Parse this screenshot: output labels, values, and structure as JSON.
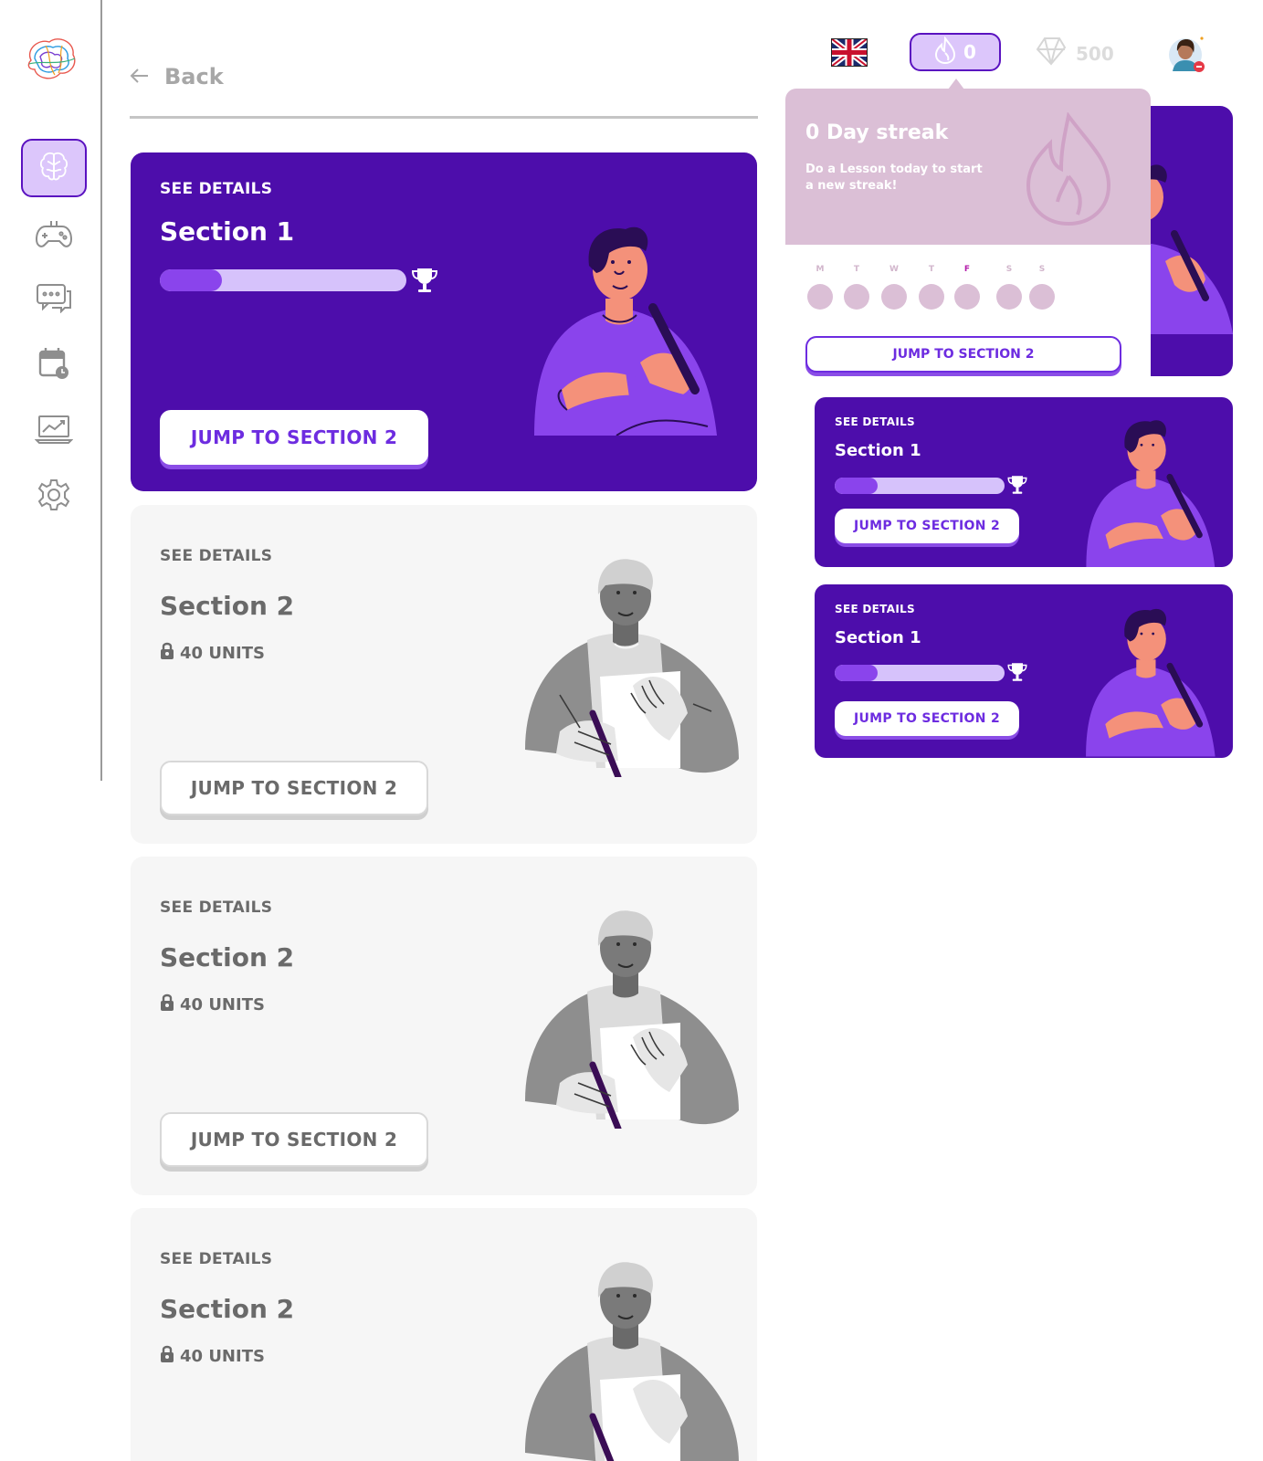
{
  "nav": {
    "back_label": "Back",
    "items": [
      {
        "name": "brain-icon",
        "active": true
      },
      {
        "name": "gamepad-icon",
        "active": false
      },
      {
        "name": "chat-icon",
        "active": false
      },
      {
        "name": "calendar-icon",
        "active": false
      },
      {
        "name": "chart-icon",
        "active": false
      },
      {
        "name": "gear-icon",
        "active": false
      }
    ]
  },
  "topbar": {
    "streak_count": "0",
    "gems": "500"
  },
  "streak_popup": {
    "title": "0 Day streak",
    "text": "Do a Lesson today to start a new streak!",
    "days": [
      "M",
      "T",
      "W",
      "T",
      "F",
      "S",
      "S"
    ],
    "today_index": 4,
    "button_label": "JUMP TO SECTION 2"
  },
  "sections": [
    {
      "see_details": "SEE DETAILS",
      "title": "Section 1",
      "button": "JUMP TO SECTION 2",
      "progress": 0.25,
      "locked": false
    },
    {
      "see_details": "SEE DETAILS",
      "title": "Section 2",
      "units": "40 UNITS",
      "button": "JUMP TO SECTION 2",
      "locked": true
    },
    {
      "see_details": "SEE DETAILS",
      "title": "Section 2",
      "units": "40 UNITS",
      "button": "JUMP TO SECTION 2",
      "locked": true
    },
    {
      "see_details": "SEE DETAILS",
      "title": "Section 2",
      "units": "40 UNITS",
      "locked": true
    }
  ],
  "mini_cards": [
    {
      "see_details": "SEE DETAILS",
      "title": "Section 1",
      "button": "JUMP TO SECTION 2",
      "progress": 0.25
    },
    {
      "see_details": "SEE DETAILS",
      "title": "Section 1",
      "button": "JUMP TO SECTION 2",
      "progress": 0.25
    }
  ],
  "colors": {
    "primary": "#4d0dab",
    "accent": "#8a44ec",
    "light": "#dcc6fb",
    "popup": "#dbbfd6"
  }
}
